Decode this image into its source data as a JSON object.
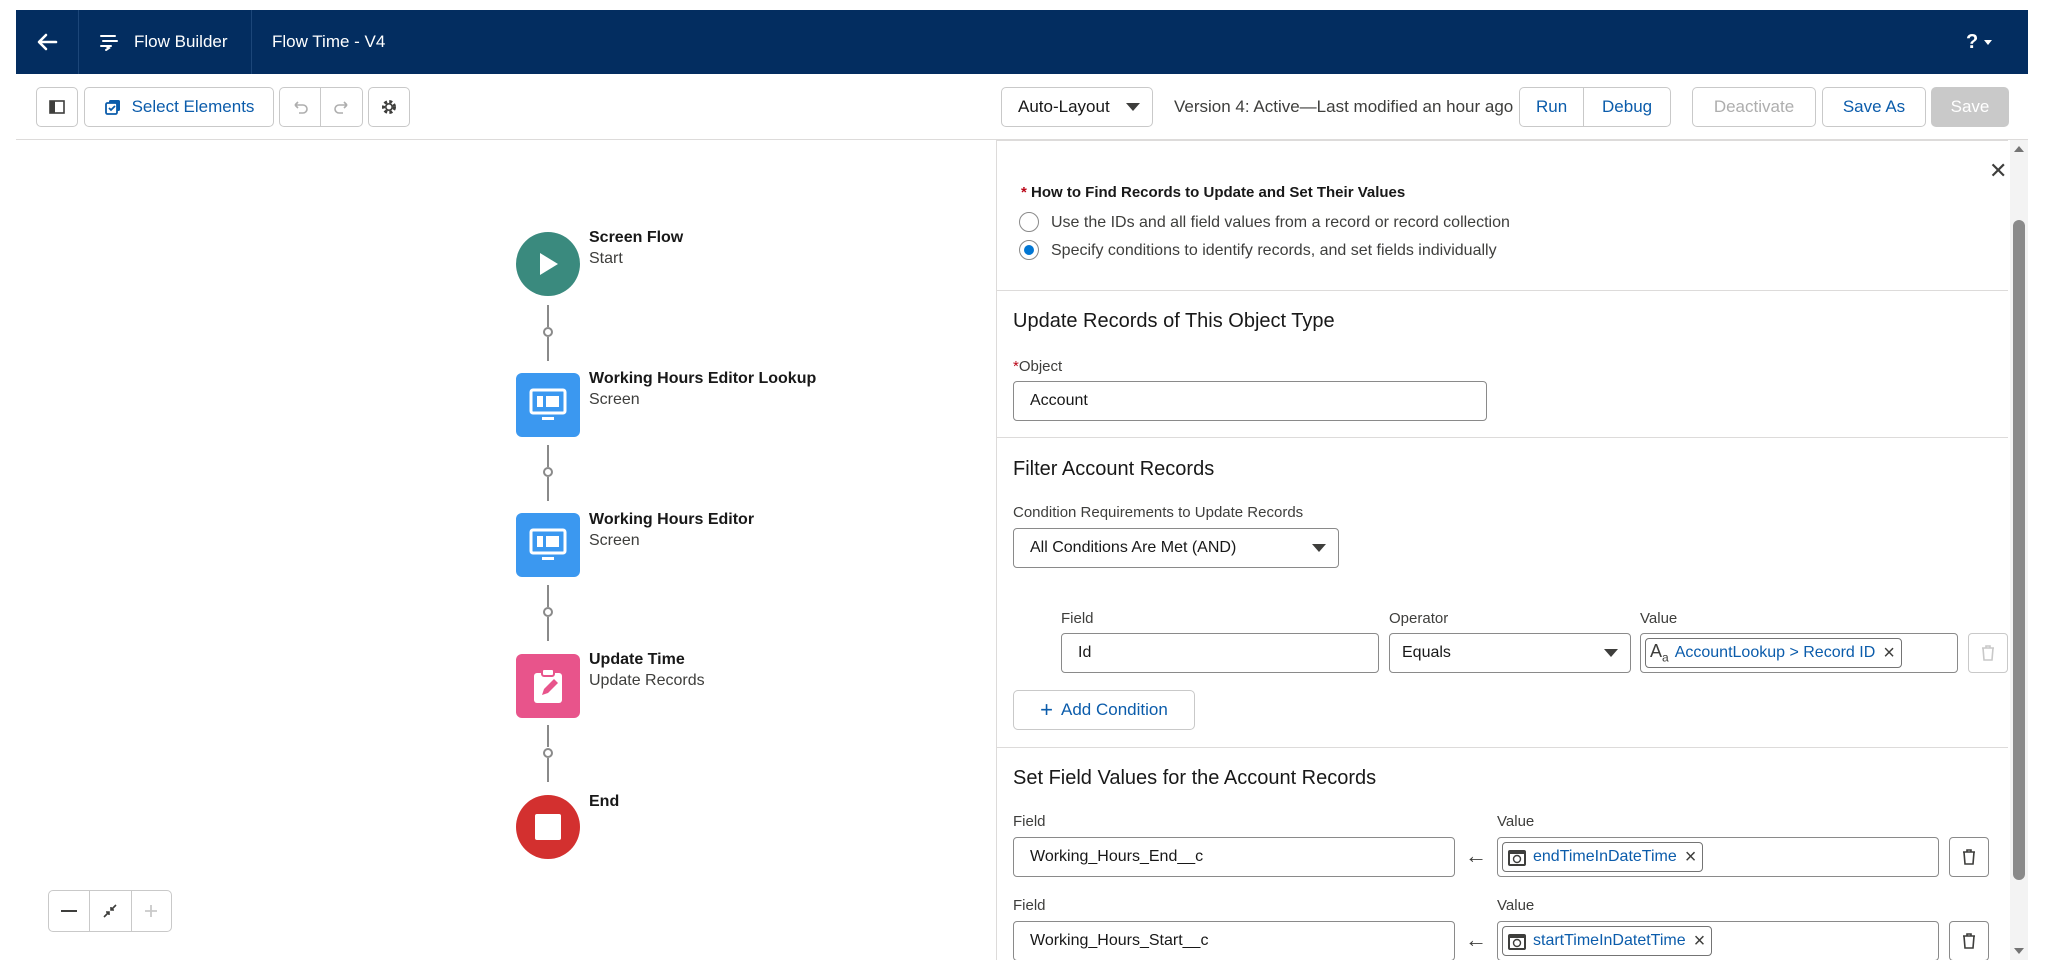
{
  "nav": {
    "back_icon": "arrow-left-icon",
    "app_icon": "flow-icon",
    "app_name": "Flow Builder",
    "flow_name": "Flow Time - V4",
    "help_label": "?",
    "colors": {
      "nav_bg": "#032d60"
    }
  },
  "toolbar": {
    "select_elements": "Select Elements",
    "layout_mode": "Auto-Layout",
    "version_status": "Version 4: Active—Last modified an hour ago",
    "run": "Run",
    "debug": "Debug",
    "deactivate": "Deactivate",
    "save_as": "Save As",
    "save": "Save"
  },
  "canvas": {
    "nodes": [
      {
        "title": "Screen Flow",
        "subtitle": "Start",
        "icon": "play-icon",
        "color": "#3a8a7e"
      },
      {
        "title": "Working Hours Editor Lookup",
        "subtitle": "Screen",
        "icon": "screen-icon",
        "color": "#3b98f0"
      },
      {
        "title": "Working Hours Editor",
        "subtitle": "Screen",
        "icon": "screen-icon",
        "color": "#3b98f0"
      },
      {
        "title": "Update Time",
        "subtitle": "Update Records",
        "icon": "update-records-icon",
        "color": "#e8548b"
      },
      {
        "title": "End",
        "subtitle": "",
        "icon": "stop-icon",
        "color": "#d3302f"
      }
    ],
    "zoom_controls": [
      "zoom-out-icon",
      "fit-icon",
      "zoom-in-icon"
    ]
  },
  "panel": {
    "how_to_label": "How to Find Records to Update and Set Their Values",
    "options": [
      {
        "label": "Use the IDs and all field values from a record or record collection",
        "selected": false
      },
      {
        "label": "Specify conditions to identify records, and set fields individually",
        "selected": true
      }
    ],
    "object_section": {
      "heading": "Update Records of This Object Type",
      "object_label": "Object",
      "object_value": "Account"
    },
    "filter_section": {
      "heading": "Filter Account Records",
      "requirements_label": "Condition Requirements to Update Records",
      "requirements_value": "All Conditions Are Met (AND)",
      "field_header": "Field",
      "operator_header": "Operator",
      "value_header": "Value",
      "condition": {
        "field": "Id",
        "operator": "Equals",
        "value": "AccountLookup > Record ID"
      },
      "add_condition": "Add Condition"
    },
    "set_section": {
      "heading": "Set Field Values for the Account Records",
      "field_label": "Field",
      "value_label": "Value",
      "rows": [
        {
          "field": "Working_Hours_End__c",
          "value": "endTimeInDateTime"
        },
        {
          "field": "Working_Hours_Start__c",
          "value": "startTimeInDatetTime"
        }
      ]
    }
  }
}
